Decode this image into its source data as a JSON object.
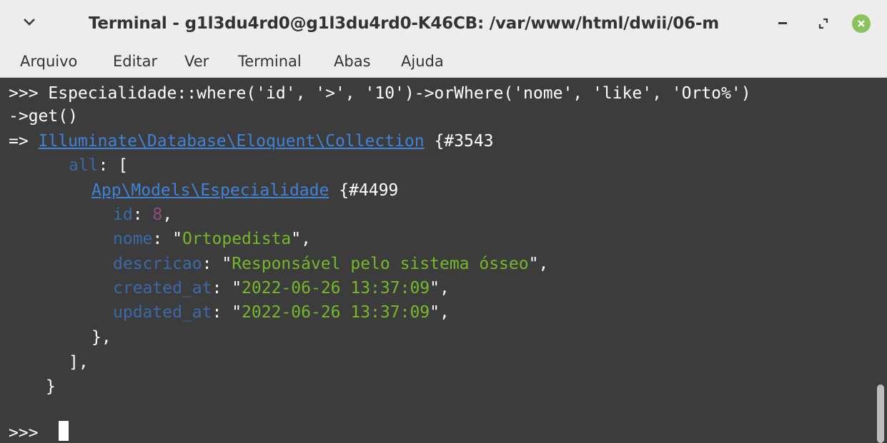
{
  "window": {
    "title": "Terminal - g1l3du4rd0@g1l3du4rd0-K46CB: /var/www/html/dwii/06-m",
    "controls": [
      "minimize-icon",
      "maximize-icon",
      "close-icon"
    ]
  },
  "menu": {
    "items": [
      "Arquivo",
      "Editar",
      "Ver",
      "Terminal",
      "Abas",
      "Ajuda"
    ]
  },
  "terminal": {
    "prompt": ">>> ",
    "command_line_1": "Especialidade::where('id', '>', '10')->orWhere('nome', 'like', 'Orto%')",
    "command_line_2": "->get()",
    "result_arrow": "=> ",
    "collection_class": "Illuminate\\Database\\Eloquent\\Collection",
    "collection_ref": " {#3543",
    "all_key": "all",
    "all_open": ": [",
    "model_class": "App\\Models\\Especialidade",
    "model_ref": " {#4499",
    "fields": [
      {
        "key": "id",
        "sep": ": ",
        "value": "8",
        "end": ","
      },
      {
        "key": "nome",
        "sep": ": ",
        "quote_open": "\"",
        "value": "Ortopedista",
        "quote_close": "\"",
        "end": ","
      },
      {
        "key": "descricao",
        "sep": ": ",
        "quote_open": "\"",
        "value": "Responsável pelo sistema ósseo",
        "quote_close": "\"",
        "end": ","
      },
      {
        "key": "created_at",
        "sep": ": ",
        "quote_open": "\"",
        "value": "2022-06-26 13:37:09",
        "quote_close": "\"",
        "end": ","
      },
      {
        "key": "updated_at",
        "sep": ": ",
        "quote_open": "\"",
        "value": "2022-06-26 13:37:09",
        "quote_close": "\"",
        "end": ","
      }
    ],
    "model_close": "},",
    "all_close": "],",
    "collection_close": "}",
    "final_prompt": ">>>"
  },
  "colors": {
    "terminal_bg": "#3c3c3c",
    "string_green": "#76b82a",
    "key_blue": "#3b6aa8",
    "link_blue": "#3f82d6",
    "number_purple": "#8a4f80",
    "close_button_green": "#8ac25b"
  }
}
